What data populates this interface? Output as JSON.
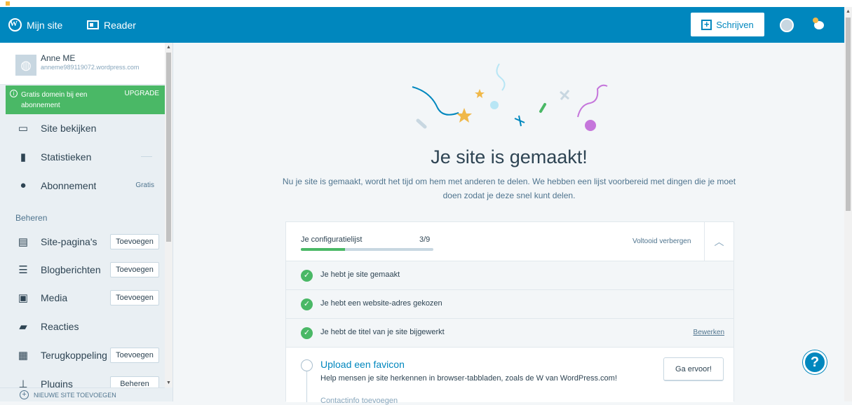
{
  "masterbar": {
    "my_site": "Mijn site",
    "reader": "Reader",
    "write": "Schrijven"
  },
  "site": {
    "name": "Anne ME",
    "url": "anneme989119072.wordpress.com"
  },
  "upgrade": {
    "text": "Gratis domein bij een abonnement",
    "action": "UPGRADE"
  },
  "sidebar": {
    "view_site": "Site bekijken",
    "stats": "Statistieken",
    "plan": "Abonnement",
    "plan_value": "Gratis",
    "manage_heading": "Beheren",
    "pages": "Site-pagina's",
    "posts": "Blogberichten",
    "media": "Media",
    "comments": "Reacties",
    "feedback": "Terugkoppeling",
    "plugins": "Plugins",
    "add_label": "Toevoegen",
    "manage_label": "Beheren",
    "new_site": "NIEUWE SITE TOEVOEGEN"
  },
  "hero": {
    "title": "Je site is gemaakt!",
    "subtitle": "Nu je site is gemaakt, wordt het tijd om hem met anderen te delen. We hebben een lijst voorbereid met dingen die je moet doen zodat je deze snel kunt delen."
  },
  "checklist": {
    "title": "Je configuratielijst",
    "count": "3/9",
    "progress": 0.333,
    "hide_completed": "Voltooid verbergen",
    "done_tasks": [
      "Je hebt je site gemaakt",
      "Je hebt een website-adres gekozen",
      "Je hebt de titel van je site bijgewerkt"
    ],
    "edit_label": "Bewerken",
    "open_task": {
      "title": "Upload een favicon",
      "description": "Help mensen je site herkennen in browser-tabbladen, zoals de W van WordPress.com!",
      "button": "Ga ervoor!"
    },
    "next_task_partial": "Contactinfo toevoegen"
  },
  "colors": {
    "brand_blue": "#0087be",
    "success_green": "#4ab866"
  }
}
